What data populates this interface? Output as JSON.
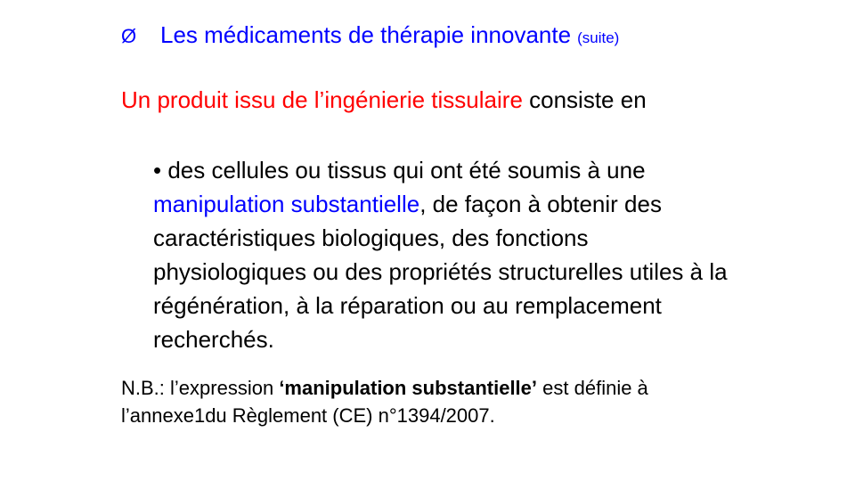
{
  "colors": {
    "title": "#0000ff",
    "highlight_red": "#ff0000",
    "highlight_blue": "#0000ff",
    "text": "#000000"
  },
  "title": {
    "arrow": "Ø",
    "text": "Les médicaments de thérapie innovante",
    "suffix": "(suite)"
  },
  "intro": {
    "highlight": "Un produit issu de l’ingénierie tissulaire",
    "rest": "consiste en"
  },
  "bullet": {
    "marker": "•",
    "part1": "des cellules ou tissus qui ont été soumis à une",
    "highlight": "manipulation substantielle",
    "part2": ", de façon à obtenir des caractéristiques biologiques, des fonctions physiologiques ou des propriétés structurelles utiles à la régénération, à la réparation ou au remplacement recherchés."
  },
  "note": {
    "prefix": "N.B.: l’expression",
    "bold": "‘manipulation substantielle’",
    "suffix": "est définie à l’annexe1du Règlement (CE) n°1394/2007."
  }
}
